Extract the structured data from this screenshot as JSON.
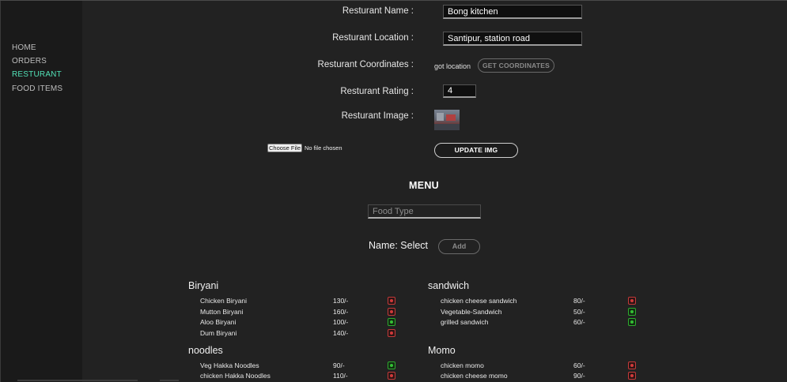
{
  "sidebar": {
    "items": [
      {
        "label": "HOME",
        "active": false
      },
      {
        "label": "ORDERS",
        "active": false
      },
      {
        "label": "RESTURANT",
        "active": true
      },
      {
        "label": "FOOD ITEMS",
        "active": false
      }
    ],
    "active_color": "#52e0b6"
  },
  "form": {
    "name_label": "Resturant Name :",
    "name_value": "Bong kitchen",
    "location_label": "Resturant Location :",
    "location_value": "Santipur, station road",
    "coordinates_label": "Resturant Coordinates :",
    "coordinates_status": "got location",
    "get_coordinates_button": "GET COORDINATES",
    "rating_label": "Resturant Rating :",
    "rating_value": "4",
    "image_label": "Resturant Image :",
    "choose_file_button": "Choose File",
    "file_status": "No file chosen",
    "update_img_button": "UPDATE IMG"
  },
  "menu": {
    "title": "MENU",
    "food_type_placeholder": "Food Type",
    "name_select": "Name: Select",
    "add_button": "Add",
    "categories": [
      {
        "name": "Biryani",
        "items": [
          {
            "name": "Chicken Biryani",
            "price": "130/-",
            "type": "nonveg"
          },
          {
            "name": "Mutton Biryani",
            "price": "160/-",
            "type": "nonveg"
          },
          {
            "name": "Aloo Biryani",
            "price": "100/-",
            "type": "veg"
          },
          {
            "name": "Dum Biryani",
            "price": "140/-",
            "type": "nonveg"
          }
        ]
      },
      {
        "name": "sandwich",
        "items": [
          {
            "name": "chicken cheese sandwich",
            "price": "80/-",
            "type": "nonveg"
          },
          {
            "name": "Vegetable-Sandwich",
            "price": "50/-",
            "type": "veg"
          },
          {
            "name": "grilled sandwich",
            "price": "60/-",
            "type": "veg"
          }
        ]
      },
      {
        "name": "noodles",
        "items": [
          {
            "name": "Veg Hakka Noodles",
            "price": "90/-",
            "type": "veg"
          },
          {
            "name": "chicken Hakka Noodles",
            "price": "110/-",
            "type": "nonveg"
          }
        ]
      },
      {
        "name": "Momo",
        "items": [
          {
            "name": "chicken momo",
            "price": "60/-",
            "type": "nonveg"
          },
          {
            "name": "chicken cheese momo",
            "price": "90/-",
            "type": "nonveg"
          }
        ]
      }
    ]
  },
  "colors": {
    "veg": "#35c035",
    "nonveg": "#d03a3a"
  }
}
